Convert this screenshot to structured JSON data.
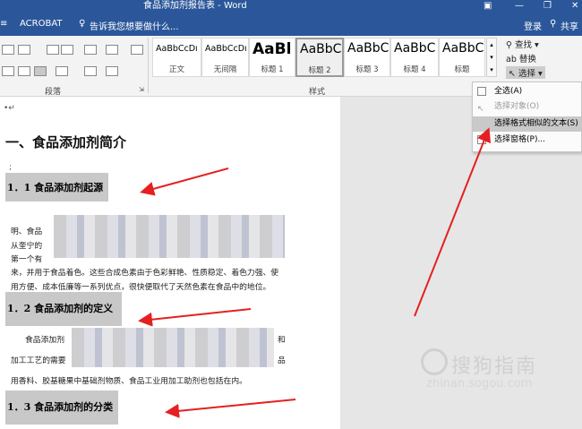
{
  "window": {
    "title": "食品添加剂报告表 - Word"
  },
  "tabs": {
    "acrobat": "ACROBAT",
    "tell_me": "告诉我您想要做什么...",
    "login": "登录",
    "share": "共享"
  },
  "ribbon": {
    "paragraph_label": "段落",
    "styles_label": "样式",
    "styles": [
      {
        "preview": "AaBbCcDı",
        "name": "正文"
      },
      {
        "preview": "AaBbCcDı",
        "name": "无间隔"
      },
      {
        "preview": "AaBl",
        "name": "标题 1"
      },
      {
        "preview": "AaBbC",
        "name": "标题 2"
      },
      {
        "preview": "AaBbC",
        "name": "标题 3"
      },
      {
        "preview": "AaBbC",
        "name": "标题 4"
      },
      {
        "preview": "AaBbC",
        "name": "标题"
      }
    ],
    "find": "查找",
    "replace": "替换",
    "select": "选择"
  },
  "select_menu": {
    "items": [
      {
        "label": "全选(A)",
        "enabled": true
      },
      {
        "label": "选择对象(O)",
        "enabled": false
      },
      {
        "label": "选择格式相似的文本(S)",
        "enabled": true
      },
      {
        "label": "选择窗格(P)...",
        "enabled": true
      }
    ]
  },
  "document": {
    "heading1": "一、食品添加剂简介",
    "heading_1_1": "1．1 食品添加剂起源",
    "heading_1_2": "1．2 食品添加剂的定义",
    "heading_1_3": "1．3 食品添加剂的分类",
    "p1_l2": "明、食品",
    "p1_l3": "从奎宁的",
    "p1_l4": "第一个有",
    "p1_l5": "来，并用于食品着色。这些合成色素由于色彩鲜艳、性质稳定、着色力强、使",
    "p1_l6": "用方便、成本低廉等一系列优点，很快便取代了天然色素在食品中的地位。",
    "p2_l1": "食品添加剂",
    "p2_l1_end": "和",
    "p2_l2": "加工工艺的需要",
    "p2_l2_end": "品",
    "p2_l3": "用香料、胶基糖果中基础剂物质、食品工业用加工助剂也包括在内。"
  },
  "watermark": {
    "brand": "搜狗指南",
    "url": "zhinan.sogou.com"
  }
}
